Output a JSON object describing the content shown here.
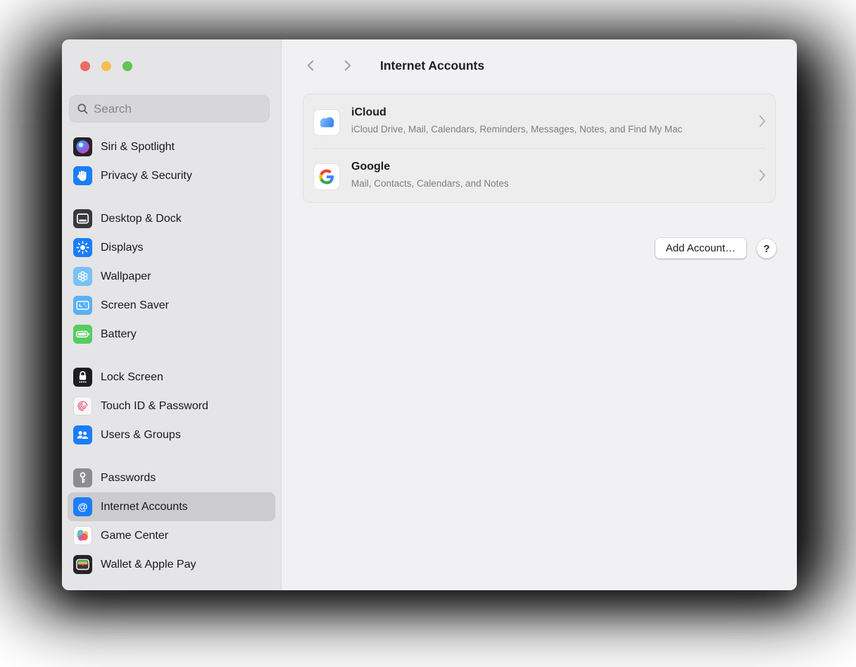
{
  "window": {
    "traffic_lights": [
      "close",
      "minimize",
      "zoom"
    ]
  },
  "sidebar": {
    "search": {
      "placeholder": "Search"
    },
    "items": [
      {
        "label": "Siri & Spotlight",
        "icon": "siri-spotlight-icon"
      },
      {
        "label": "Privacy & Security",
        "icon": "privacy-security-icon"
      },
      {
        "label": "Desktop & Dock",
        "icon": "desktop-dock-icon"
      },
      {
        "label": "Displays",
        "icon": "displays-icon"
      },
      {
        "label": "Wallpaper",
        "icon": "wallpaper-icon"
      },
      {
        "label": "Screen Saver",
        "icon": "screen-saver-icon"
      },
      {
        "label": "Battery",
        "icon": "battery-icon"
      },
      {
        "label": "Lock Screen",
        "icon": "lock-screen-icon"
      },
      {
        "label": "Touch ID & Password",
        "icon": "touch-id-icon"
      },
      {
        "label": "Users & Groups",
        "icon": "users-groups-icon"
      },
      {
        "label": "Passwords",
        "icon": "passwords-icon"
      },
      {
        "label": "Internet Accounts",
        "icon": "internet-accounts-icon",
        "selected": true
      },
      {
        "label": "Game Center",
        "icon": "game-center-icon"
      },
      {
        "label": "Wallet & Apple Pay",
        "icon": "wallet-apple-pay-icon"
      }
    ]
  },
  "header": {
    "title": "Internet Accounts"
  },
  "accounts": [
    {
      "name": "iCloud",
      "description": "iCloud Drive, Mail, Calendars, Reminders, Messages, Notes, and Find My Mac",
      "icon": "icloud-icon"
    },
    {
      "name": "Google",
      "description": "Mail, Contacts, Calendars, and Notes",
      "icon": "google-icon"
    }
  ],
  "actions": {
    "add_account": "Add Account…",
    "help": "?"
  },
  "icons": {
    "at_symbol": "@"
  },
  "colors": {
    "accent_blue": "#1b7ef6",
    "traffic_red": "#ed6a5f",
    "traffic_yellow": "#f5bf4f",
    "traffic_green": "#61c454",
    "sidebar_selected": "#cccbce"
  }
}
